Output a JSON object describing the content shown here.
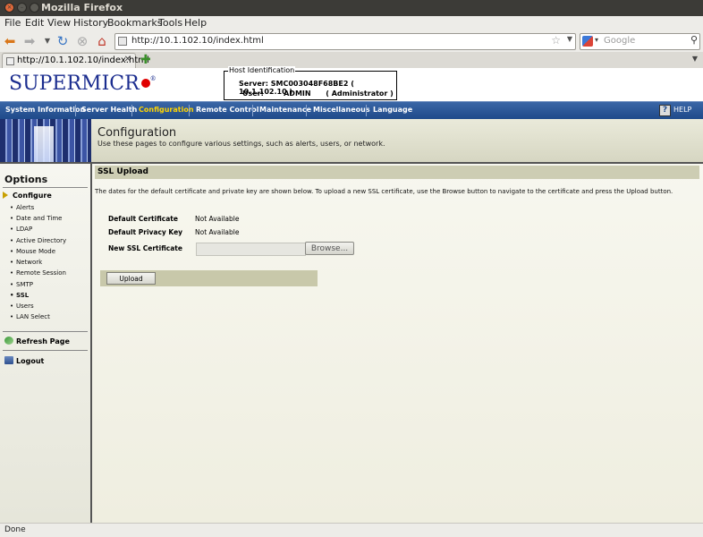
{
  "window": {
    "title": "Mozilla Firefox"
  },
  "menubar": {
    "items": [
      "File",
      "Edit",
      "View",
      "History",
      "Bookmarks",
      "Tools",
      "Help"
    ]
  },
  "toolbar": {
    "url": "http://10.1.102.10/index.html",
    "search_placeholder": "Google"
  },
  "tabs": [
    {
      "label": "http://10.1.102.10/index.html"
    }
  ],
  "header": {
    "logo": "SUPERMICR",
    "host": {
      "legend": "Host Identification",
      "server_label": "Server:",
      "server_value": "SMC003048F68BE2 (   10.1.102.10   )",
      "user_label": "User:",
      "user_value": "ADMIN",
      "user_role": "( Administrator )"
    }
  },
  "nav": {
    "items": [
      "System Information",
      "Server Health",
      "Configuration",
      "Remote Control",
      "Maintenance",
      "Miscellaneous",
      "Language"
    ],
    "active": "Configuration",
    "help": "HELP"
  },
  "banner": {
    "title": "Configuration",
    "subtitle": "Use these pages to configure various settings, such as alerts, users, or network."
  },
  "sidebar": {
    "title": "Options",
    "section": "Configure",
    "items": [
      "Alerts",
      "Date and Time",
      "LDAP",
      "Active Directory",
      "Mouse Mode",
      "Network",
      "Remote Session",
      "SMTP",
      "SSL",
      "Users",
      "LAN Select"
    ],
    "selected": "SSL",
    "refresh": "Refresh Page",
    "logout": "Logout"
  },
  "content": {
    "title": "SSL Upload",
    "description": "The dates for the default certificate and private key are shown below. To upload a new SSL certificate, use the Browse button to navigate to the certificate and press the Upload button.",
    "fields": [
      {
        "label": "Default Certificate",
        "value": "Not Available"
      },
      {
        "label": "Default Privacy Key",
        "value": "Not Available"
      },
      {
        "label": "New SSL Certificate",
        "value": ""
      }
    ],
    "browse_label": "Browse...",
    "upload_label": "Upload"
  },
  "status": {
    "text": "Done"
  },
  "colors": {
    "nav_bg": "#1f4a8a",
    "nav_active": "#ffd400",
    "logo_blue": "#1b2d8f",
    "logo_red": "#e00000"
  }
}
